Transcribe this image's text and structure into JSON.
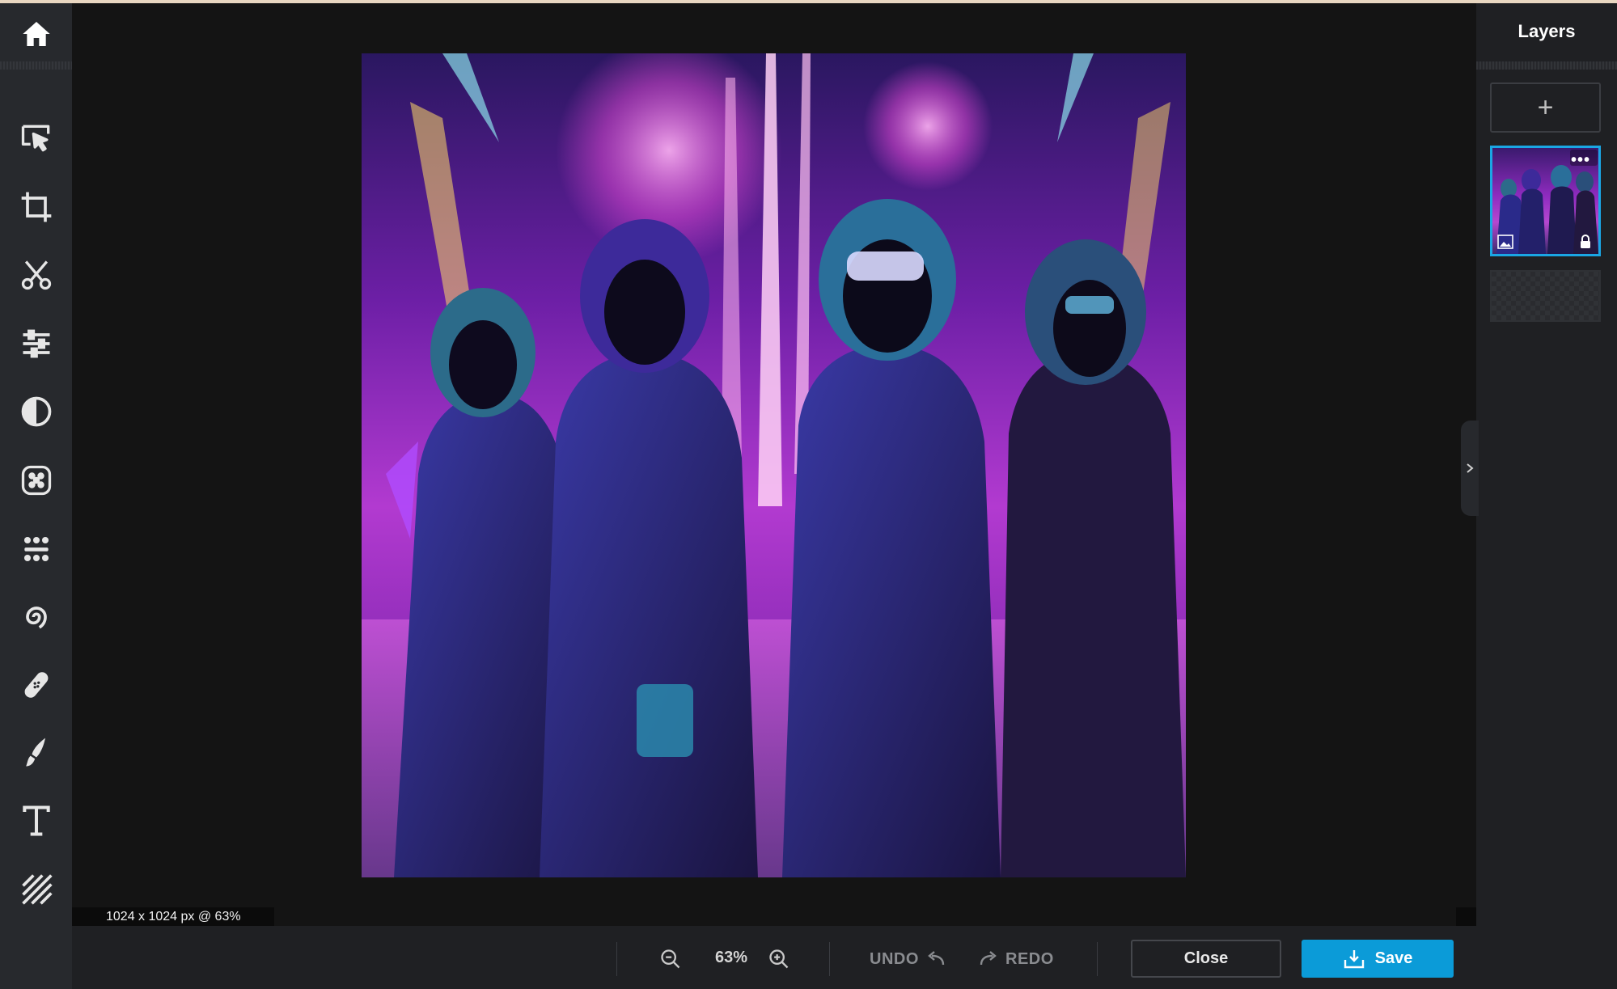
{
  "toolbar": {
    "tools": [
      {
        "name": "home-icon"
      },
      {
        "name": "select-icon"
      },
      {
        "name": "crop-icon"
      },
      {
        "name": "cutout-icon"
      },
      {
        "name": "adjust-icon"
      },
      {
        "name": "contrast-icon"
      },
      {
        "name": "effects-icon"
      },
      {
        "name": "filters-icon"
      },
      {
        "name": "distort-icon"
      },
      {
        "name": "retouch-icon"
      },
      {
        "name": "draw-icon"
      },
      {
        "name": "text-icon"
      },
      {
        "name": "texture-icon"
      }
    ]
  },
  "canvas": {
    "size_label": "1024 x 1024 px @ 63%"
  },
  "layers": {
    "title": "Layers",
    "add_label": "+"
  },
  "bottom_bar": {
    "zoom": "63%",
    "undo_label": "UNDO",
    "redo_label": "REDO",
    "close_label": "Close",
    "save_label": "Save"
  },
  "colors": {
    "accent": "#0b9bd8",
    "toolbar_bg": "#27292d",
    "canvas_bg": "#141414"
  }
}
